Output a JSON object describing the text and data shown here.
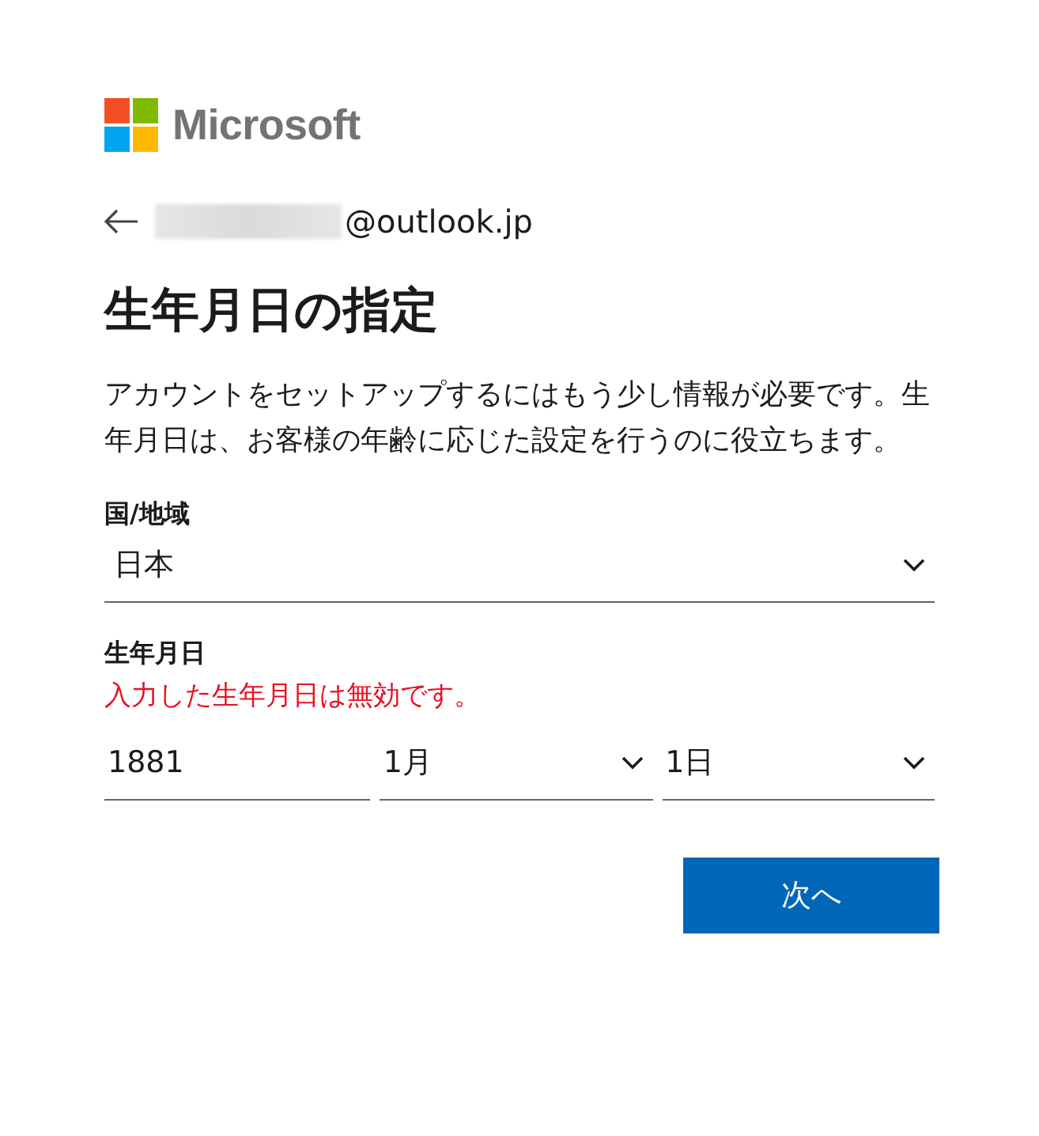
{
  "logo": {
    "text": "Microsoft"
  },
  "identity": {
    "email_suffix": "@outlook.jp"
  },
  "heading": "生年月日の指定",
  "description": "アカウントをセットアップするにはもう少し情報が必要です。生年月日は、お客様の年齢に応じた設定を行うのに役立ちます。",
  "country": {
    "label": "国/地域",
    "value": "日本"
  },
  "birthdate": {
    "label": "生年月日",
    "error": "入力した生年月日は無効です。",
    "fields": [
      {
        "kind": "input",
        "value": "1881"
      },
      {
        "kind": "select",
        "value": "1月"
      },
      {
        "kind": "select",
        "value": "1日"
      }
    ]
  },
  "buttons": [
    {
      "label": "次へ"
    }
  ]
}
